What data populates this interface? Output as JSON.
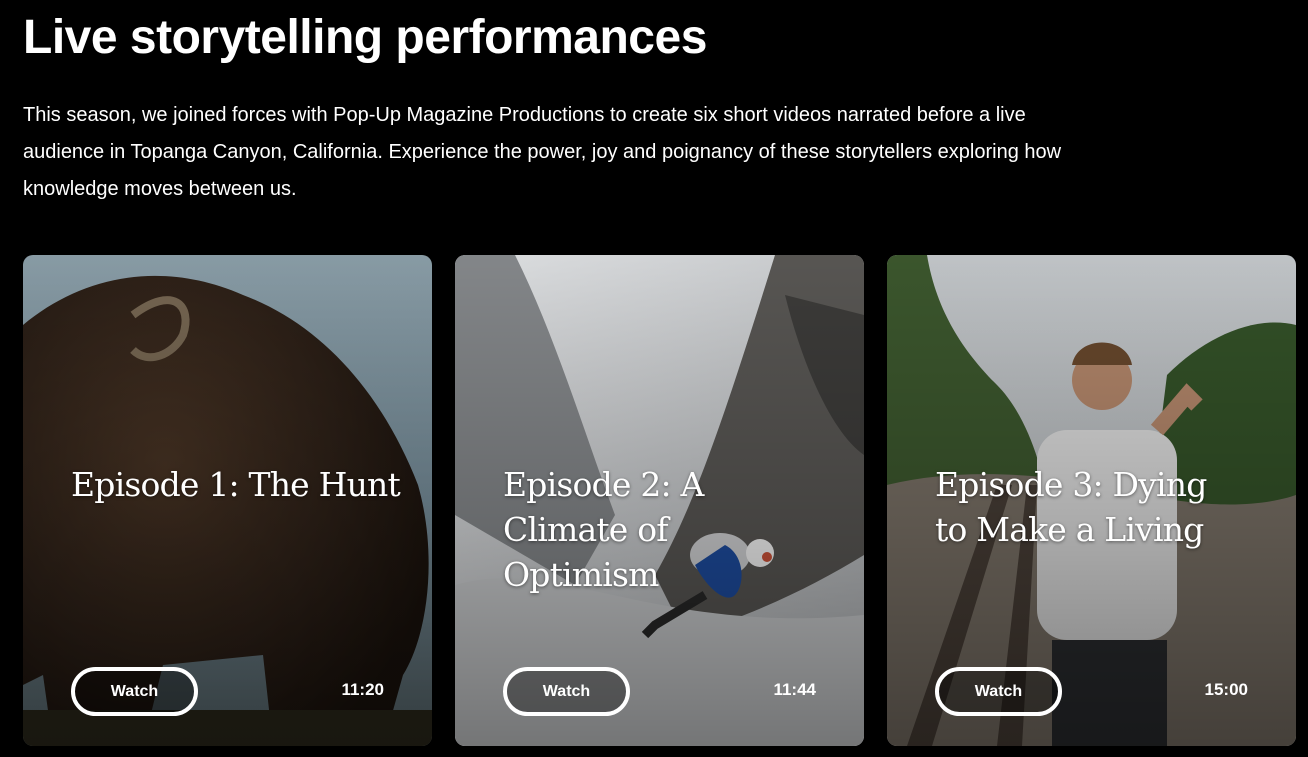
{
  "header": {
    "title": "Live storytelling performances",
    "intro": "This season, we joined forces with Pop-Up Magazine Productions to create six short videos narrated before a live audience in Topanga Canyon, California. Experience the power, joy and poignancy of these storytellers exploring how knowledge moves between us."
  },
  "episodes": [
    {
      "title": "Episode 1: The Hunt",
      "button_label": "Watch",
      "duration": "11:20"
    },
    {
      "title": "Episode 2: A Climate of Optimism",
      "button_label": "Watch",
      "duration": "11:44"
    },
    {
      "title": "Episode 3: Dying to Make a Living",
      "button_label": "Watch",
      "duration": "15:00"
    }
  ],
  "colors": {
    "background": "#000000",
    "text": "#ffffff"
  }
}
